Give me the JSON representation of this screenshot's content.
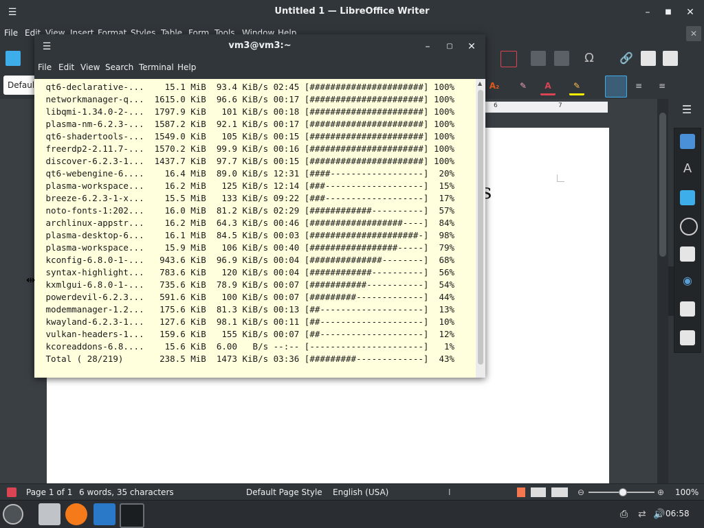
{
  "writer": {
    "title": "Untitled 1 — LibreOffice Writer",
    "menu": [
      "File",
      "Edit",
      "View",
      "Insert",
      "Format",
      "Styles",
      "Table",
      "Form",
      "Tools",
      "Window",
      "Help"
    ],
    "para_style": "Default",
    "ruler_marks": [
      "6",
      "7"
    ],
    "page_text_fragment": "s",
    "status": {
      "page": "Page 1 of 1",
      "words": "6 words, 35 characters",
      "page_style": "Default Page Style",
      "language": "English (USA)",
      "zoom": "100%"
    }
  },
  "terminal": {
    "title": "vm3@vm3:~",
    "menu": [
      "File",
      "Edit",
      "View",
      "Search",
      "Terminal",
      "Help"
    ],
    "lines": [
      " qt6-declarative-...    15.1 MiB  93.4 KiB/s 02:45 [######################] 100%",
      " networkmanager-q...  1615.0 KiB  96.6 KiB/s 00:17 [######################] 100%",
      " libqmi-1.34.0-2-...  1797.9 KiB   101 KiB/s 00:18 [######################] 100%",
      " plasma-nm-6.2.3-...  1587.2 KiB  92.1 KiB/s 00:17 [######################] 100%",
      " qt6-shadertools-...  1549.0 KiB   105 KiB/s 00:15 [######################] 100%",
      " freerdp2-2.11.7-...  1570.2 KiB  99.9 KiB/s 00:16 [######################] 100%",
      " discover-6.2.3-1...  1437.7 KiB  97.7 KiB/s 00:15 [######################] 100%",
      " qt6-webengine-6....    16.4 MiB  89.0 KiB/s 12:31 [####------------------]  20%",
      " plasma-workspace...    16.2 MiB   125 KiB/s 12:14 [###-------------------]  15%",
      " breeze-6.2.3-1-x...    15.5 MiB   133 KiB/s 09:22 [###-------------------]  17%",
      " noto-fonts-1:202...    16.0 MiB  81.2 KiB/s 02:29 [############----------]  57%",
      " archlinux-appstr...    16.2 MiB  64.3 KiB/s 00:46 [##################----]  84%",
      " plasma-desktop-6...    16.1 MiB  84.5 KiB/s 00:03 [#####################-]  98%",
      " plasma-workspace...    15.9 MiB   106 KiB/s 00:40 [#################-----]  79%",
      " kconfig-6.8.0-1-...   943.6 KiB  96.9 KiB/s 00:04 [##############--------]  68%",
      " syntax-highlight...   783.6 KiB   120 KiB/s 00:04 [############----------]  56%",
      " kxmlgui-6.8.0-1-...   735.6 KiB  78.9 KiB/s 00:07 [###########-----------]  54%",
      " powerdevil-6.2.3...   591.6 KiB   100 KiB/s 00:07 [#########-------------]  44%",
      " modemmanager-1.2...   175.6 KiB  81.3 KiB/s 00:13 [##--------------------]  13%",
      " kwayland-6.2.3-1...   127.6 KiB  98.1 KiB/s 00:11 [##--------------------]  10%",
      " vulkan-headers-1...   159.6 KiB   155 KiB/s 00:07 [##--------------------]  12%",
      " kcoreaddons-6.8....    15.6 KiB  6.00   B/s --:-- [----------------------]   1%",
      " Total ( 28/219)       238.5 MiB  1473 KiB/s 03:36 [#########-------------]  43%"
    ]
  },
  "taskbar": {
    "clock": "06:58",
    "apps": [
      "app-launcher-icon",
      "file-manager-icon",
      "firefox-icon",
      "writer-icon",
      "terminal-icon"
    ]
  },
  "colors": {
    "window_bg": "#31363b",
    "terminal_bg": "#ffffdd",
    "page_bg": "#ffffff",
    "accent": "#3daee9"
  }
}
